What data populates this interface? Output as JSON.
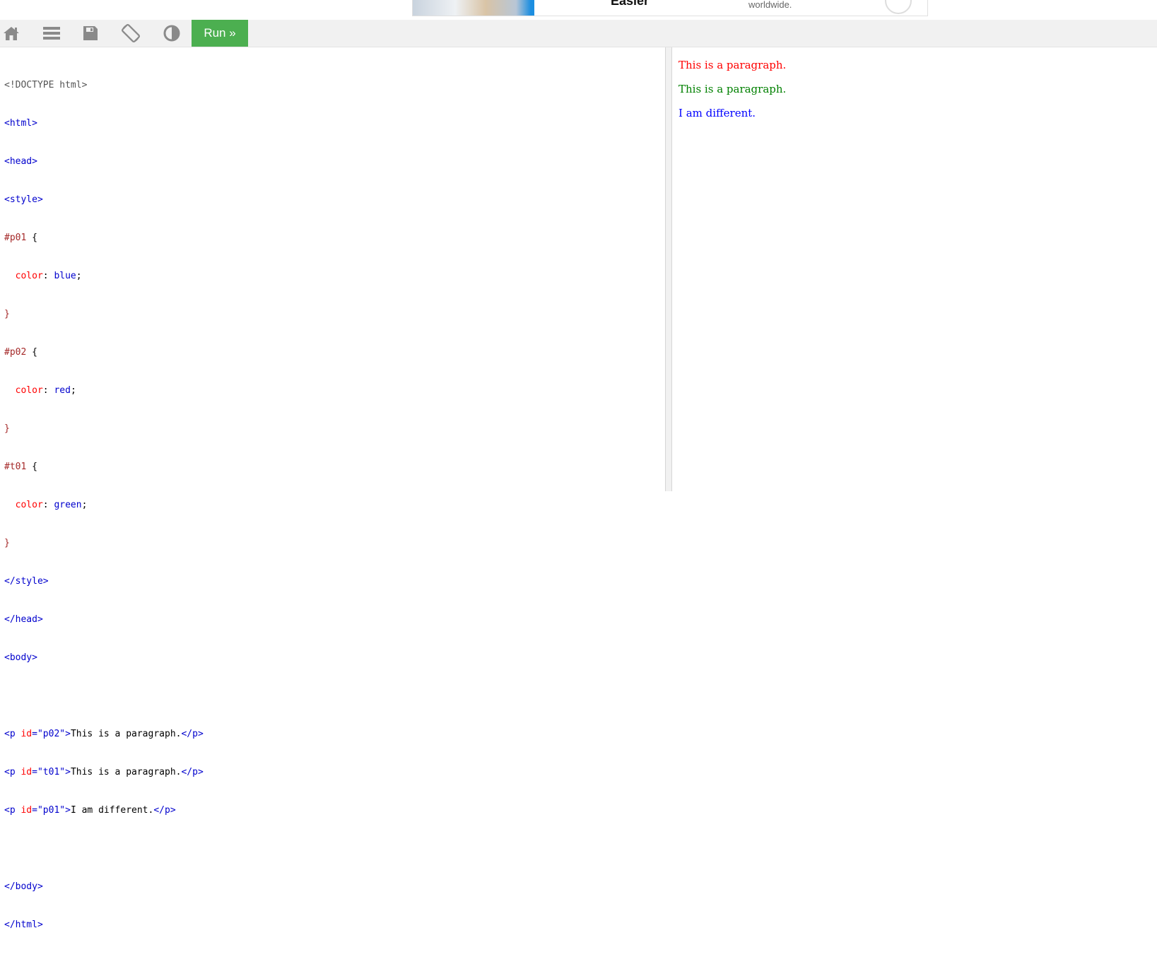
{
  "ad": {
    "title": "Easier",
    "text": "worldwide."
  },
  "toolbar": {
    "icons": [
      "home-icon",
      "menu-icon",
      "save-icon",
      "rotate-icon",
      "contrast-icon"
    ],
    "run_label": "Run »"
  },
  "editor": {
    "lines": {
      "l1": "<!DOCTYPE html>",
      "l2": "<html>",
      "l3": "<head>",
      "l4": "<style>",
      "l5_sel": "#p01",
      "l5_rest": " {",
      "l6_prop": "color",
      "l6_val": "blue",
      "l7": "}",
      "l8_sel": "#p02",
      "l8_rest": " {",
      "l9_prop": "color",
      "l9_val": "red",
      "l10": "}",
      "l11_sel": "#t01",
      "l11_rest": " {",
      "l12_prop": "color",
      "l12_val": "green",
      "l13": "}",
      "l14": "</style>",
      "l15": "</head>",
      "l16": "<body>",
      "l18_id": "\"p02\"",
      "l18_text": "This is a paragraph.",
      "l19_id": "\"t01\"",
      "l19_text": "This is a paragraph.",
      "l20_id": "\"p01\"",
      "l20_text": "I am different.",
      "l22": "</body>",
      "l23": "</html>"
    }
  },
  "preview": {
    "p1": "This is a paragraph.",
    "p2": "This is a paragraph.",
    "p3": "I am different.",
    "p1_color": "#ff0000",
    "p2_color": "#008000",
    "p3_color": "#0000ff"
  },
  "colors": {
    "run_button": "#4caf50",
    "toolbar_bg": "#f1f1f1",
    "icon_gray": "#8a8a8a"
  }
}
